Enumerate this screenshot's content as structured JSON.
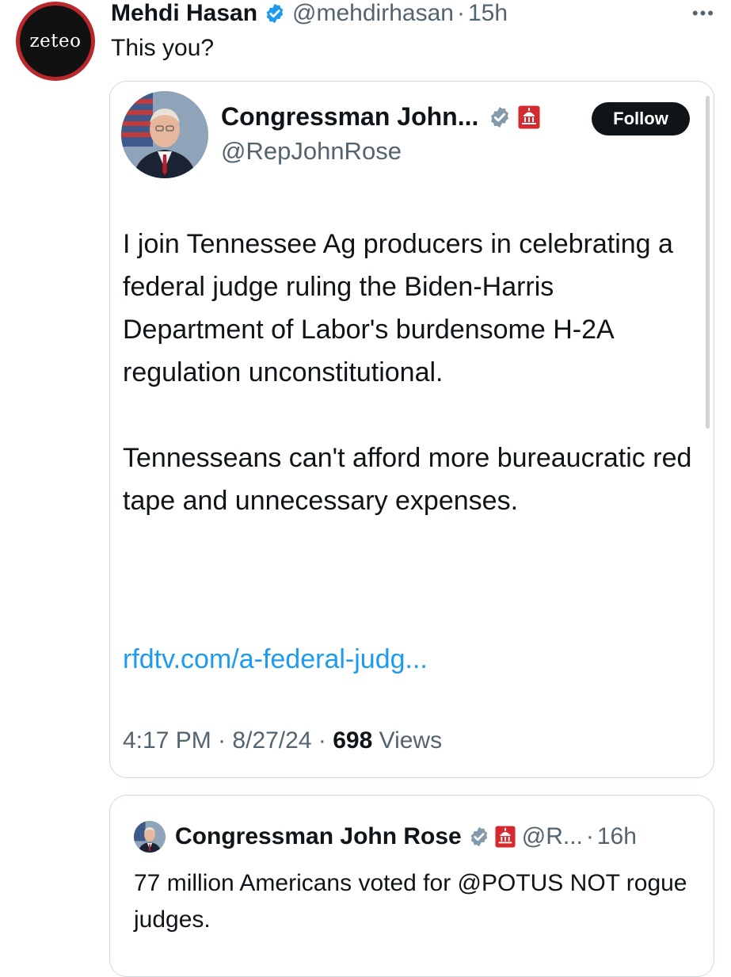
{
  "tweet": {
    "avatar_text": "zeteo",
    "author_name": "Mehdi Hasan",
    "handle": "@mehdirhasan",
    "separator": "·",
    "time": "15h",
    "text": "This you?",
    "more_icon": "more-horizontal-icon"
  },
  "quoted": {
    "author_name": "Congressman John...",
    "handle": "@RepJohnRose",
    "follow_label": "Follow",
    "paragraph1": "I join Tennessee Ag producers in celebrating a federal judge ruling the Biden-Harris Department of Labor's burdensome H-2A regulation unconstitutional.",
    "paragraph2": "Tennesseans can't afford more bureaucratic red tape and unnecessary expenses.",
    "link": "rfdtv.com/a-federal-judg...",
    "time": "4:17 PM",
    "date": "8/27/24",
    "views_count": "698",
    "views_label": "Views",
    "separator": "·"
  },
  "second_quote": {
    "author_name": "Congressman John Rose",
    "handle": "@R...",
    "separator": "·",
    "time": "16h",
    "text": "77 million Americans voted for @POTUS NOT rogue judges."
  },
  "colors": {
    "verified_blue": "#1d9bf0",
    "verified_gray": "#829aab",
    "gov_badge_red": "#d42a2f",
    "link_blue": "#1d9bf0",
    "text_secondary": "#536471"
  }
}
